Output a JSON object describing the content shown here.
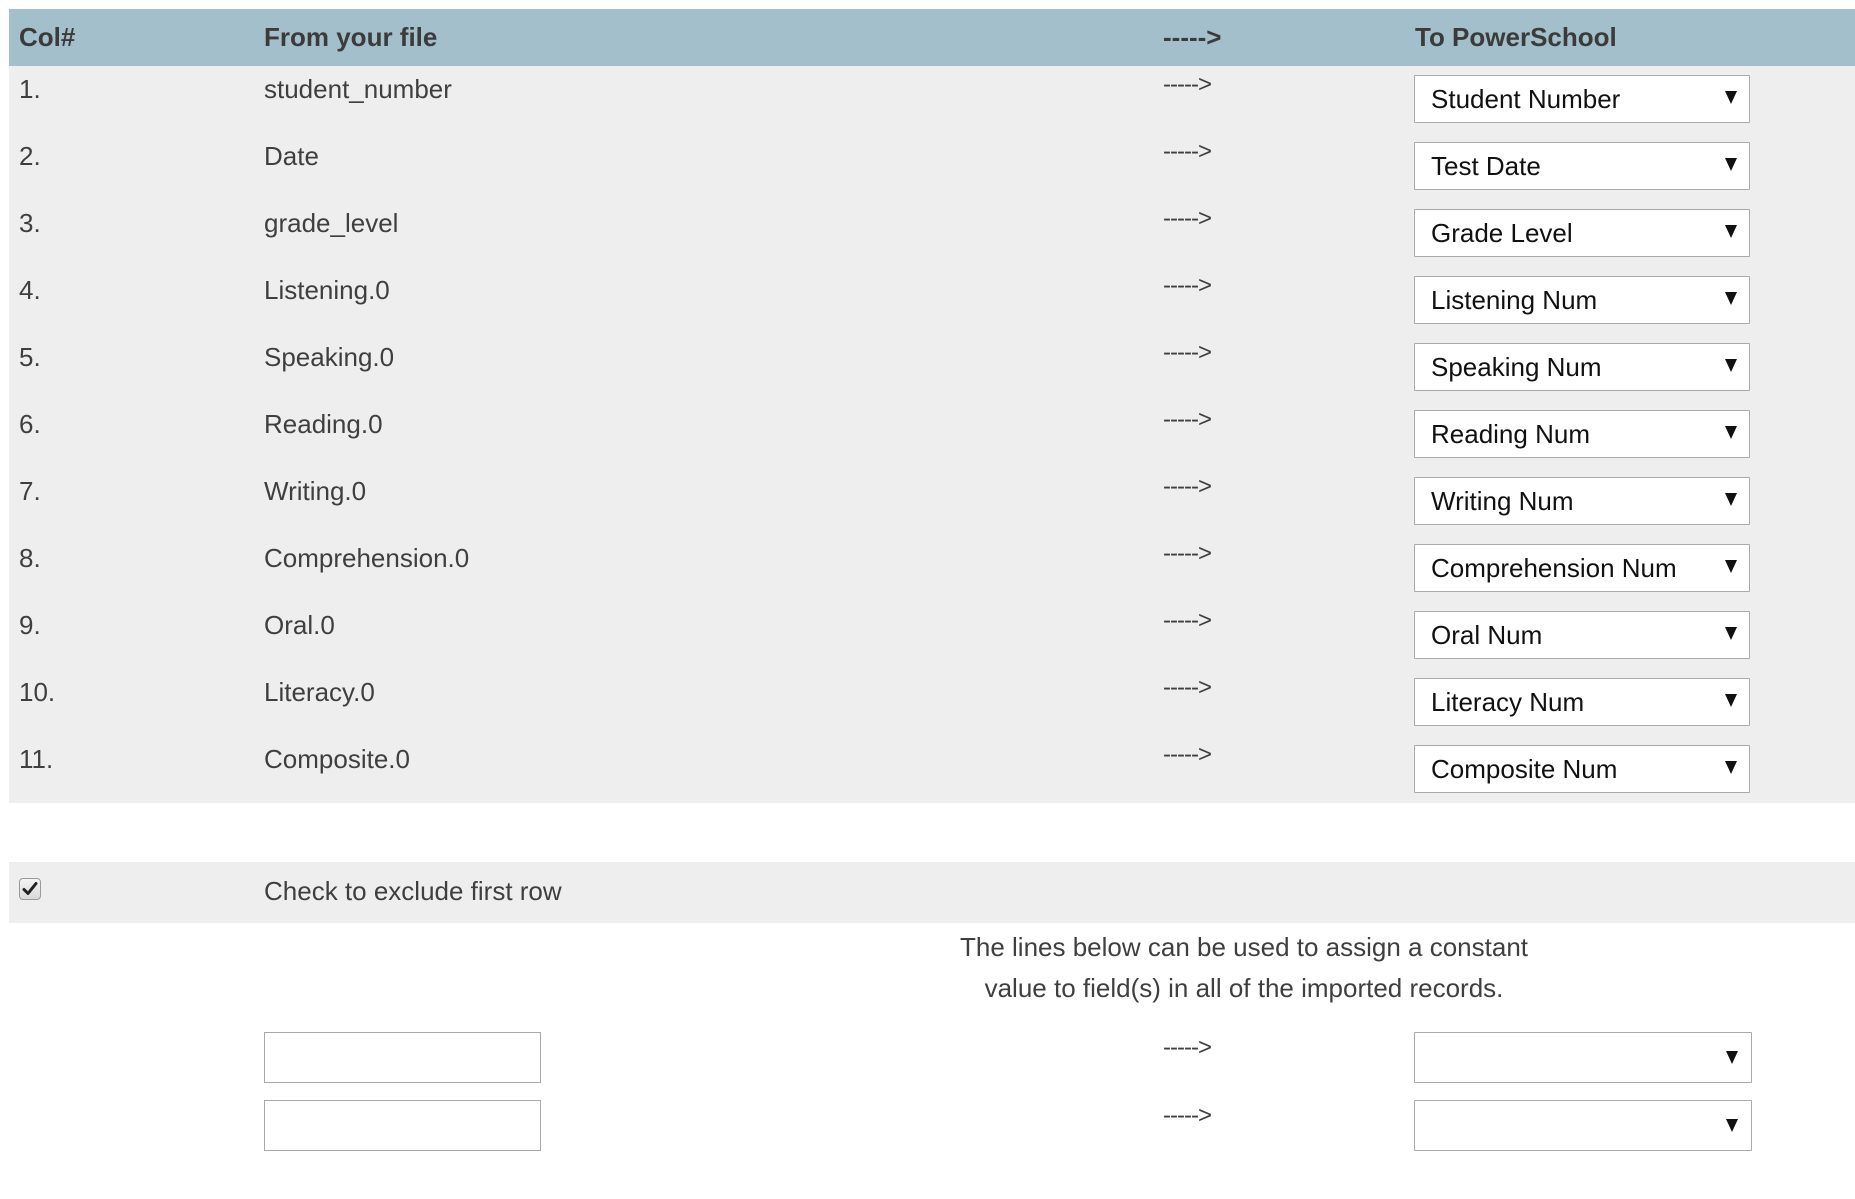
{
  "header": {
    "col_num": "Col#",
    "from_file": "From your file",
    "arrow": "----->",
    "to_powerschool": "To PowerSchool"
  },
  "rows": [
    {
      "num": "1.",
      "from": "student_number",
      "arrow": "----->",
      "to": "Student Number"
    },
    {
      "num": "2.",
      "from": "Date",
      "arrow": "----->",
      "to": "Test Date"
    },
    {
      "num": "3.",
      "from": "grade_level",
      "arrow": "----->",
      "to": "Grade Level"
    },
    {
      "num": "4.",
      "from": "Listening.0",
      "arrow": "----->",
      "to": "Listening Num"
    },
    {
      "num": "5.",
      "from": "Speaking.0",
      "arrow": "----->",
      "to": "Speaking Num"
    },
    {
      "num": "6.",
      "from": "Reading.0",
      "arrow": "----->",
      "to": "Reading Num"
    },
    {
      "num": "7.",
      "from": "Writing.0",
      "arrow": "----->",
      "to": "Writing Num"
    },
    {
      "num": "8.",
      "from": "Comprehension.0",
      "arrow": "----->",
      "to": "Comprehension Num"
    },
    {
      "num": "9.",
      "from": "Oral.0",
      "arrow": "----->",
      "to": "Oral Num"
    },
    {
      "num": "10.",
      "from": "Literacy.0",
      "arrow": "----->",
      "to": "Literacy Num"
    },
    {
      "num": "11.",
      "from": "Composite.0",
      "arrow": "----->",
      "to": "Composite Num"
    }
  ],
  "exclude_first_row": {
    "label": "Check to exclude first row",
    "checked": true
  },
  "constants": {
    "instructions_line1": "The lines below can be used to assign a constant",
    "instructions_line2": "value to field(s) in all of the imported records.",
    "lines": [
      {
        "value": "",
        "arrow": "----->",
        "to": ""
      },
      {
        "value": "",
        "arrow": "----->",
        "to": ""
      }
    ]
  },
  "colors": {
    "header_bg": "#a3bfcb",
    "row_bg": "#eeeeee"
  }
}
